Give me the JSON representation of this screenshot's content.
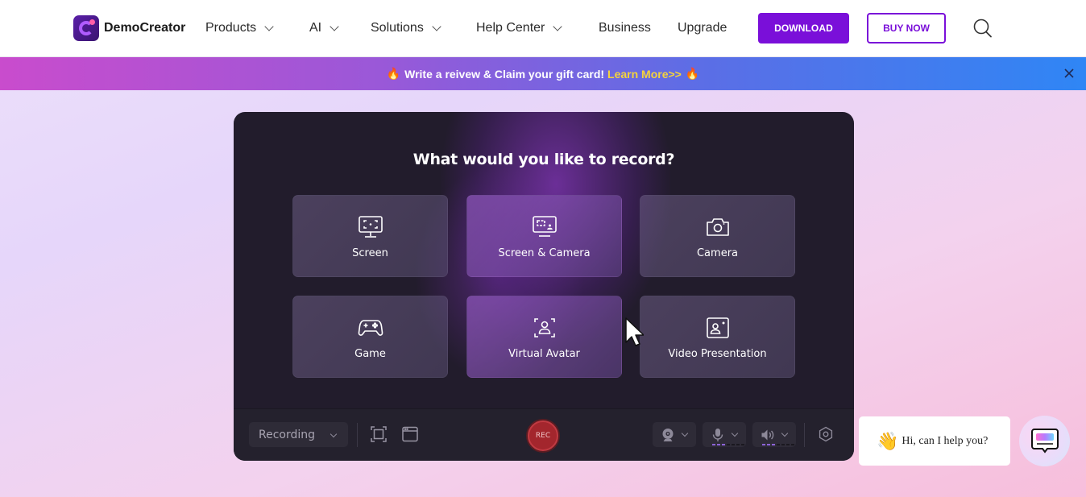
{
  "header": {
    "brand": "DemoCreator",
    "nav": [
      {
        "label": "Products",
        "has_dropdown": true
      },
      {
        "label": "AI",
        "has_dropdown": true
      },
      {
        "label": "Solutions",
        "has_dropdown": true
      },
      {
        "label": "Help Center",
        "has_dropdown": true
      },
      {
        "label": "Business",
        "has_dropdown": false
      },
      {
        "label": "Upgrade",
        "has_dropdown": false
      }
    ],
    "download_label": "DOWNLOAD",
    "buy_label": "BUY NOW",
    "search_icon": "search-icon",
    "accent_color": "#7a0fd9"
  },
  "promo": {
    "text": "Write a reivew & Claim your gift card!",
    "link": "Learn More>>",
    "emoji_left": "🔥",
    "emoji_right": "🔥",
    "link_color": "#f5d33c"
  },
  "recorder": {
    "title": "What would you like to record?",
    "tiles": [
      {
        "label": "Screen",
        "icon": "monitor-capture-icon"
      },
      {
        "label": "Screen & Camera",
        "icon": "monitor-person-icon"
      },
      {
        "label": "Camera",
        "icon": "camera-icon"
      },
      {
        "label": "Game",
        "icon": "gamepad-icon"
      },
      {
        "label": "Virtual Avatar",
        "icon": "avatar-frame-icon"
      },
      {
        "label": "Video Presentation",
        "icon": "presentation-icon"
      }
    ],
    "toolbar": {
      "mode": "Recording",
      "rec_label": "REC",
      "mic_level_on": 3,
      "mic_level_total": 7,
      "speaker_level_on": 3,
      "speaker_level_total": 7
    }
  },
  "chat": {
    "greeting": "Hi, can I help you?",
    "emoji": "👋"
  }
}
